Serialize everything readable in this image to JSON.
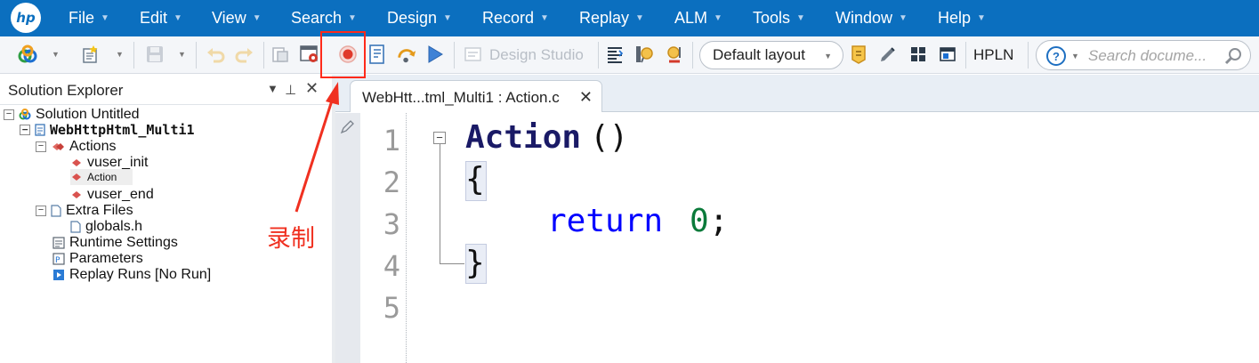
{
  "menu": {
    "logo": "hp",
    "items": [
      {
        "label": "File"
      },
      {
        "label": "Edit"
      },
      {
        "label": "View"
      },
      {
        "label": "Search"
      },
      {
        "label": "Design"
      },
      {
        "label": "Record"
      },
      {
        "label": "Replay"
      },
      {
        "label": "ALM"
      },
      {
        "label": "Tools"
      },
      {
        "label": "Window"
      },
      {
        "label": "Help"
      }
    ]
  },
  "toolbar": {
    "design_studio_label": "Design Studio",
    "layout_value": "Default layout",
    "hpln_label": "HPLN",
    "search_placeholder": "Search docume..."
  },
  "solution_explorer": {
    "title": "Solution Explorer",
    "tree": {
      "solution": "Solution Untitled",
      "script": "WebHttpHtml_Multi1",
      "actions": "Actions",
      "vuser_init": "vuser_init",
      "action": "Action",
      "vuser_end": "vuser_end",
      "extra_files": "Extra Files",
      "globals": "globals.h",
      "runtime_settings": "Runtime Settings",
      "parameters": "Parameters",
      "replay_runs": "Replay Runs [No Run]"
    }
  },
  "editor": {
    "tab_label": "WebHtt...tml_Multi1 : Action.c",
    "line_numbers": [
      "1",
      "2",
      "3",
      "4",
      "5"
    ],
    "code": {
      "func_name": "Action",
      "parens": "()",
      "open_brace": "{",
      "return_kw": "return",
      "return_value": "0",
      "semicolon": ";",
      "close_brace": "}"
    }
  },
  "annotation": {
    "label": "录制",
    "color": "#ff2a1a"
  },
  "colors": {
    "menubar": "#0b6fbf",
    "keyword": "#0000ff",
    "number": "#0a7a3a",
    "identifier": "#1a1a66"
  }
}
